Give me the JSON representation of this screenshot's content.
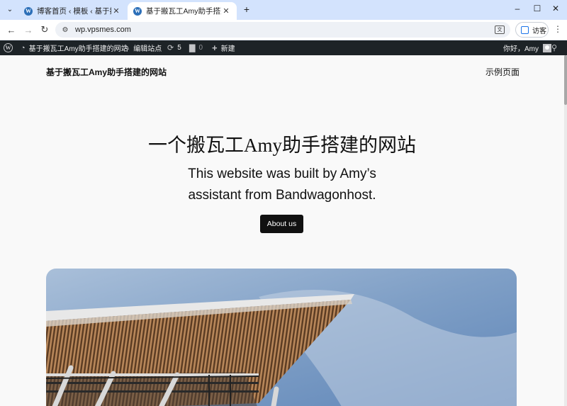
{
  "browser": {
    "tabs": [
      {
        "title": "博客首页 ‹ 模板 ‹ 基于搬瓦工Amy助手搭建的网站 — WordPress",
        "active": false,
        "icon": "wordpress-icon"
      },
      {
        "title": "基于搬瓦工Amy助手搭建的网站",
        "active": true,
        "icon": "wordpress-icon"
      }
    ],
    "tab_close_glyph": "✕",
    "new_tab_glyph": "+",
    "url": "wp.vpsmes.com",
    "guest_label": "访客",
    "window_controls": {
      "minimize": "–",
      "maximize": "☐",
      "close": "✕"
    }
  },
  "admin_bar": {
    "site_name": "基于搬瓦工Amy助手搭建的网站",
    "customize_label": "编辑站点",
    "updates_count": "5",
    "comments_count": "0",
    "new_label": "新建",
    "greeting": "你好，Amy"
  },
  "site": {
    "title": "基于搬瓦工Amy助手搭建的网站",
    "nav_link": "示例页面",
    "hero_title": "一个搬瓦工Amy助手搭建的网站",
    "hero_subtitle": "This website was built by Amy’s assistant from Bandwagonhost.",
    "cta_label": "About us"
  },
  "colors": {
    "tabstrip": "#d3e3fd",
    "admin_bar": "#1d2327",
    "page_bg": "#f9f9f9",
    "button_bg": "#111111",
    "accent_blue": "#1a73e8"
  }
}
